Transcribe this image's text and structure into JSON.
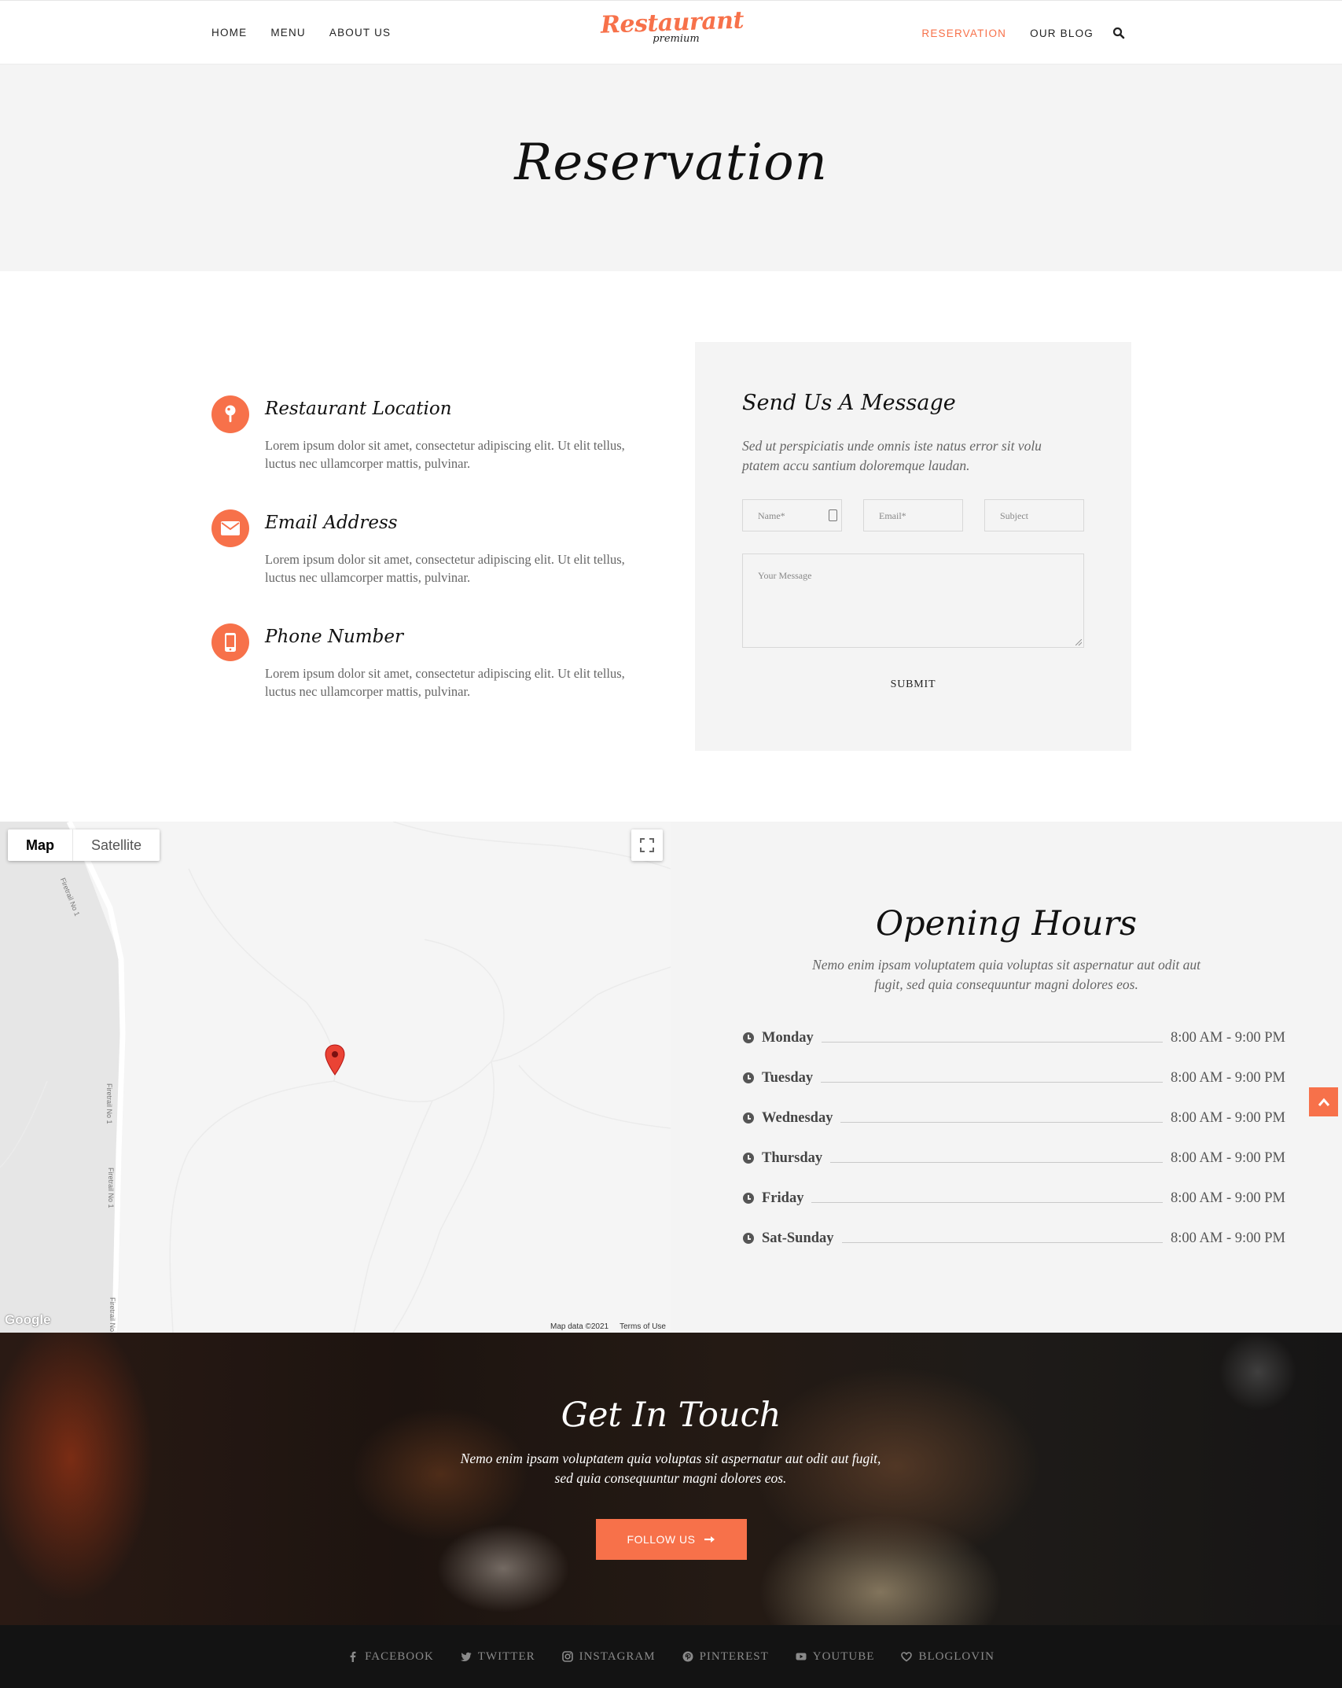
{
  "header": {
    "nav_left": [
      "HOME",
      "MENU",
      "ABOUT US"
    ],
    "nav_right": [
      "RESERVATION",
      "OUR BLOG"
    ],
    "logo": {
      "main": "Restaurant",
      "sub": "premium"
    },
    "accent_color": "#f7714a"
  },
  "page_title": "Reservation",
  "contact_info": [
    {
      "icon": "location-pin-icon",
      "title": "Restaurant Location",
      "text": "Lorem ipsum dolor sit amet, consectetur adipiscing elit. Ut elit tellus, luctus nec ullamcorper mattis, pulvinar."
    },
    {
      "icon": "envelope-icon",
      "title": "Email Address",
      "text": "Lorem ipsum dolor sit amet, consectetur adipiscing elit. Ut elit tellus, luctus nec ullamcorper mattis, pulvinar."
    },
    {
      "icon": "mobile-phone-icon",
      "title": "Phone Number",
      "text": "Lorem ipsum dolor sit amet, consectetur adipiscing elit. Ut elit tellus, luctus nec ullamcorper mattis, pulvinar."
    }
  ],
  "message_form": {
    "title": "Send Us A Message",
    "description": "Sed ut perspiciatis unde omnis iste natus error sit volu ptatem accu santium doloremque laudan.",
    "name_placeholder": "Name*",
    "email_placeholder": "Email*",
    "subject_placeholder": "Subject",
    "message_placeholder": "Your Message",
    "submit_label": "SUBMIT"
  },
  "map": {
    "type_map": "Map",
    "type_satellite": "Satellite",
    "google": "Google",
    "map_data": "Map data ©2021",
    "terms": "Terms of Use",
    "road_label": "Firetrail No 1"
  },
  "opening_hours": {
    "title": "Opening Hours",
    "description": "Nemo enim ipsam voluptatem quia voluptas sit aspernatur aut odit aut fugit, sed quia consequuntur magni dolores eos.",
    "rows": [
      {
        "day": "Monday",
        "time": "8:00 AM - 9:00 PM"
      },
      {
        "day": "Tuesday",
        "time": "8:00 AM - 9:00 PM"
      },
      {
        "day": "Wednesday",
        "time": "8:00 AM - 9:00 PM"
      },
      {
        "day": "Thursday",
        "time": "8:00 AM - 9:00 PM"
      },
      {
        "day": "Friday",
        "time": "8:00 AM - 9:00 PM"
      },
      {
        "day": "Sat-Sunday",
        "time": "8:00 AM - 9:00 PM"
      }
    ]
  },
  "get_in_touch": {
    "title": "Get In Touch",
    "description": "Nemo enim ipsam voluptatem quia voluptas sit aspernatur aut odit aut fugit, sed quia consequuntur magni dolores eos.",
    "button_label": "FOLLOW US"
  },
  "footer": {
    "social": [
      "FACEBOOK",
      "TWITTER",
      "INSTAGRAM",
      "PINTEREST",
      "YOUTUBE",
      "BLOGLOVIN"
    ]
  }
}
